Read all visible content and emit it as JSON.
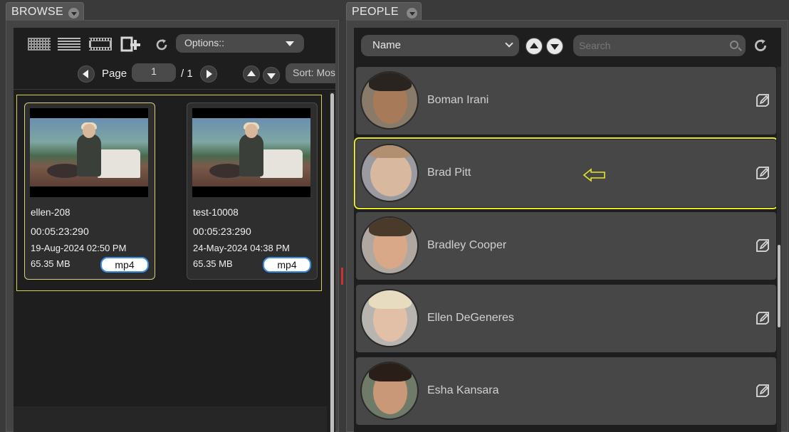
{
  "browse": {
    "tab_label": "BROWSE",
    "options_label": "Options::",
    "page_label": "Page",
    "page_value": "1",
    "page_total": "/ 1",
    "sort_label": "Sort: Most Recent",
    "items": [
      {
        "name": "ellen-208",
        "duration": "00:05:23:290",
        "date": "19-Aug-2024 02:50 PM",
        "size": "65.35 MB",
        "format": "mp4"
      },
      {
        "name": "test-10008",
        "duration": "00:05:23:290",
        "date": "24-May-2024 04:38 PM",
        "size": "65.35 MB",
        "format": "mp4"
      }
    ]
  },
  "people": {
    "tab_label": "PEOPLE",
    "sort_field": "Name",
    "search_placeholder": "Search",
    "list": [
      {
        "name": "Boman Irani"
      },
      {
        "name": "Brad Pitt"
      },
      {
        "name": "Bradley Cooper"
      },
      {
        "name": "Ellen DeGeneres"
      },
      {
        "name": "Esha Kansara"
      }
    ],
    "selected_index": 1
  },
  "colors": {
    "highlight": "#e5e52a",
    "badge_border": "#3b8ee6",
    "background": "#1e1e1e"
  }
}
